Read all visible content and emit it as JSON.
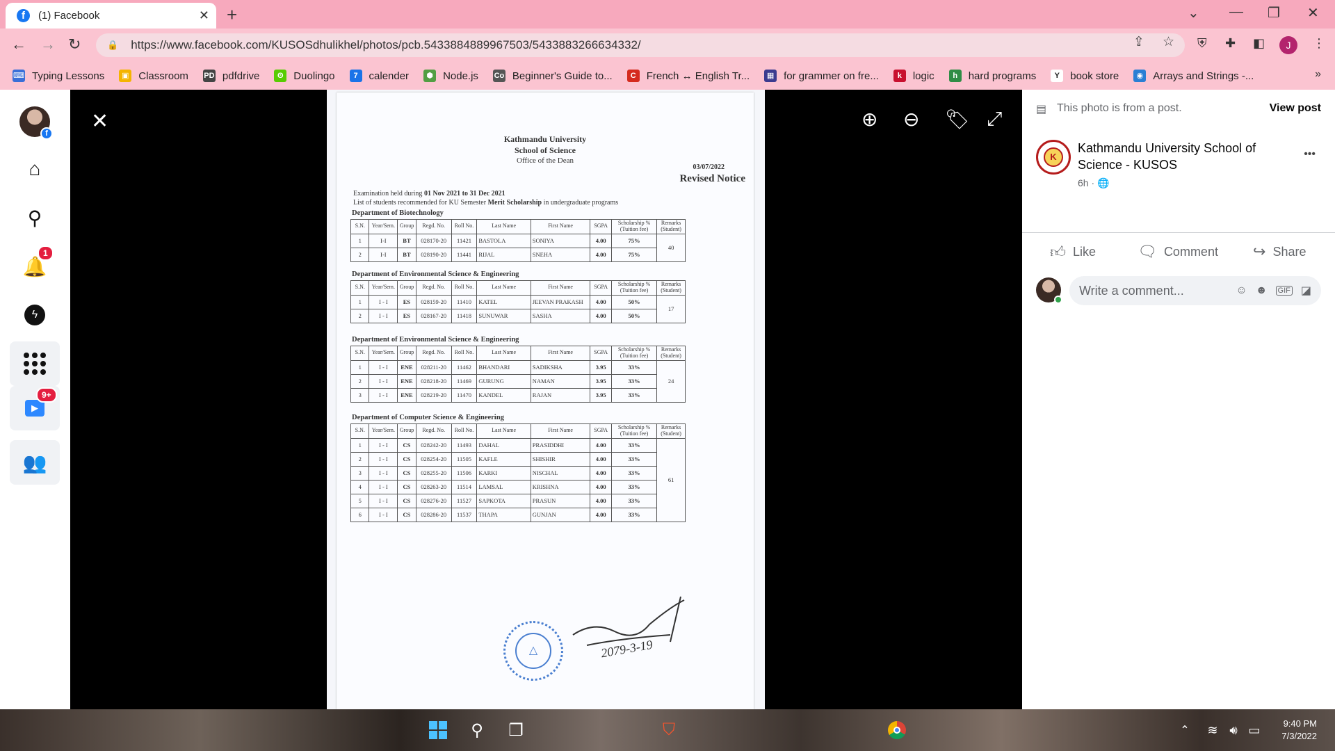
{
  "browser": {
    "tab_title": "(1) Facebook",
    "tab_close": "✕",
    "new_tab": "+",
    "url": "https://www.facebook.com/KUSOSdhulikhel/photos/pcb.5433884889967503/5433883266634332/",
    "profile_initial": "J",
    "bookmarks": [
      {
        "label": "Typing Lessons",
        "icon_color": "#3a6fd8",
        "icon_text": "⌨"
      },
      {
        "label": "Classroom",
        "icon_color": "#f4b400",
        "icon_text": "▣"
      },
      {
        "label": "pdfdrive",
        "icon_color": "#444444",
        "icon_text": "PD"
      },
      {
        "label": "Duolingo",
        "icon_color": "#58cc02",
        "icon_text": "ʘ"
      },
      {
        "label": "calender",
        "icon_color": "#1a73e8",
        "icon_text": "7"
      },
      {
        "label": "Node.js",
        "icon_color": "#539e43",
        "icon_text": "⬢"
      },
      {
        "label": "Beginner's Guide to...",
        "icon_color": "#555555",
        "icon_text": "Co"
      },
      {
        "label": "French ↔ English Tr...",
        "icon_color": "#d52b1e",
        "icon_text": "C"
      },
      {
        "label": "for grammer on fre...",
        "icon_color": "#3b3b8f",
        "icon_text": "▦"
      },
      {
        "label": "logic",
        "icon_color": "#c8102e",
        "icon_text": "k"
      },
      {
        "label": "hard programs",
        "icon_color": "#2f8d46",
        "icon_text": "h"
      },
      {
        "label": "book store",
        "icon_color": "#ffffff",
        "icon_text": "Y"
      },
      {
        "label": "Arrays and Strings -...",
        "icon_color": "#2a7fd4",
        "icon_text": "◉"
      }
    ],
    "bookmarks_more": "»"
  },
  "facebook": {
    "notification_badge": "1",
    "watch_badge": "9+"
  },
  "notice": {
    "university": "Kathmandu University",
    "school": "School of Science",
    "office": "Office of the Dean",
    "date": "03/07/2022",
    "notice_title": "Revised Notice",
    "intro_line1_a": "Examination held during ",
    "intro_line1_b": "01 Nov 2021 to 31 Dec 2021",
    "intro_line2_a": "List of students recommended for KU Semester ",
    "intro_line2_b": "Merit Scholarship",
    "intro_line2_c": " in undergraduate programs",
    "columns": [
      "S.N.",
      "Year/Sem.",
      "Group",
      "Regd. No.",
      "Roll No.",
      "Last Name",
      "First Name",
      "SGPA",
      "Scholarship % (Tuition fee)",
      "Remarks (Student)"
    ],
    "departments": [
      {
        "name": "Department of Biotechnology",
        "remark": "40",
        "rows": [
          [
            "1",
            "I-I",
            "BT",
            "028170-20",
            "11421",
            "BASTOLA",
            "SONIYA",
            "4.00",
            "75%"
          ],
          [
            "2",
            "I-I",
            "BT",
            "028190-20",
            "11441",
            "RIJAL",
            "SNEHA",
            "4.00",
            "75%"
          ]
        ]
      },
      {
        "name": "Department of Environmental Science & Engineering",
        "remark": "17",
        "rows": [
          [
            "1",
            "I - I",
            "ES",
            "028159-20",
            "11410",
            "KATEL",
            "JEEVAN PRAKASH",
            "4.00",
            "50%"
          ],
          [
            "2",
            "I - I",
            "ES",
            "028167-20",
            "11418",
            "SUNUWAR",
            "SASHA",
            "4.00",
            "50%"
          ]
        ]
      },
      {
        "name": "Department of Environmental Science & Engineering",
        "remark": "24",
        "rows": [
          [
            "1",
            "I - I",
            "ENE",
            "028211-20",
            "11462",
            "BHANDARI",
            "SADIKSHA",
            "3.95",
            "33%"
          ],
          [
            "2",
            "I - I",
            "ENE",
            "028218-20",
            "11469",
            "GURUNG",
            "NAMAN",
            "3.95",
            "33%"
          ],
          [
            "3",
            "I - I",
            "ENE",
            "028219-20",
            "11470",
            "KANDEL",
            "RAJAN",
            "3.95",
            "33%"
          ]
        ]
      },
      {
        "name": "Department of Computer Science & Engineering",
        "remark": "61",
        "rows": [
          [
            "1",
            "I - I",
            "CS",
            "028242-20",
            "11493",
            "DAHAL",
            "PRASIDDHI",
            "4.00",
            "33%"
          ],
          [
            "2",
            "I - I",
            "CS",
            "028254-20",
            "11505",
            "KAFLE",
            "SHISHIR",
            "4.00",
            "33%"
          ],
          [
            "3",
            "I - I",
            "CS",
            "028255-20",
            "11506",
            "KARKI",
            "NISCHAL",
            "4.00",
            "33%"
          ],
          [
            "4",
            "I - I",
            "CS",
            "028263-20",
            "11514",
            "LAMSAL",
            "KRISHNA",
            "4.00",
            "33%"
          ],
          [
            "5",
            "I - I",
            "CS",
            "028276-20",
            "11527",
            "SAPKOTA",
            "PRASUN",
            "4.00",
            "33%"
          ],
          [
            "6",
            "I - I",
            "CS",
            "028286-20",
            "11537",
            "THAPA",
            "GUNJAN",
            "4.00",
            "33%"
          ]
        ]
      }
    ],
    "signature_date": "2079-3-19"
  },
  "sidebar": {
    "photo_from_post": "This photo is from a post.",
    "view_post": "View post",
    "page_name": "Kathmandu University School of Science - KUSOS",
    "time": "6h ·",
    "more": "•••",
    "like": "Like",
    "comment": "Comment",
    "share": "Share",
    "comment_placeholder": "Write a comment..."
  },
  "taskbar": {
    "time": "9:40 PM",
    "date": "7/3/2022"
  }
}
